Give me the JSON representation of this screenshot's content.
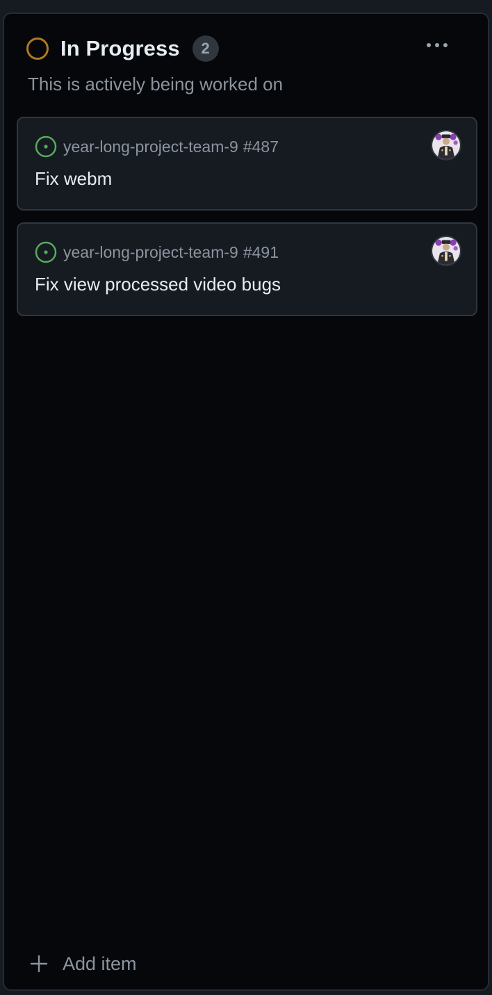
{
  "column": {
    "title": "In Progress",
    "count": "2",
    "description": "This is actively being worked on",
    "status_color": "#b07a24",
    "more_icon": "kebab-horizontal-icon"
  },
  "cards": [
    {
      "repo": "year-long-project-team-9",
      "number": "#487",
      "title": "Fix webm",
      "state_icon": "issue-open-icon",
      "state_color": "#57ab5a"
    },
    {
      "repo": "year-long-project-team-9",
      "number": "#491",
      "title": "Fix view processed video bugs",
      "state_icon": "issue-open-icon",
      "state_color": "#57ab5a"
    }
  ],
  "footer": {
    "add_label": "Add item",
    "add_icon": "plus-icon"
  }
}
